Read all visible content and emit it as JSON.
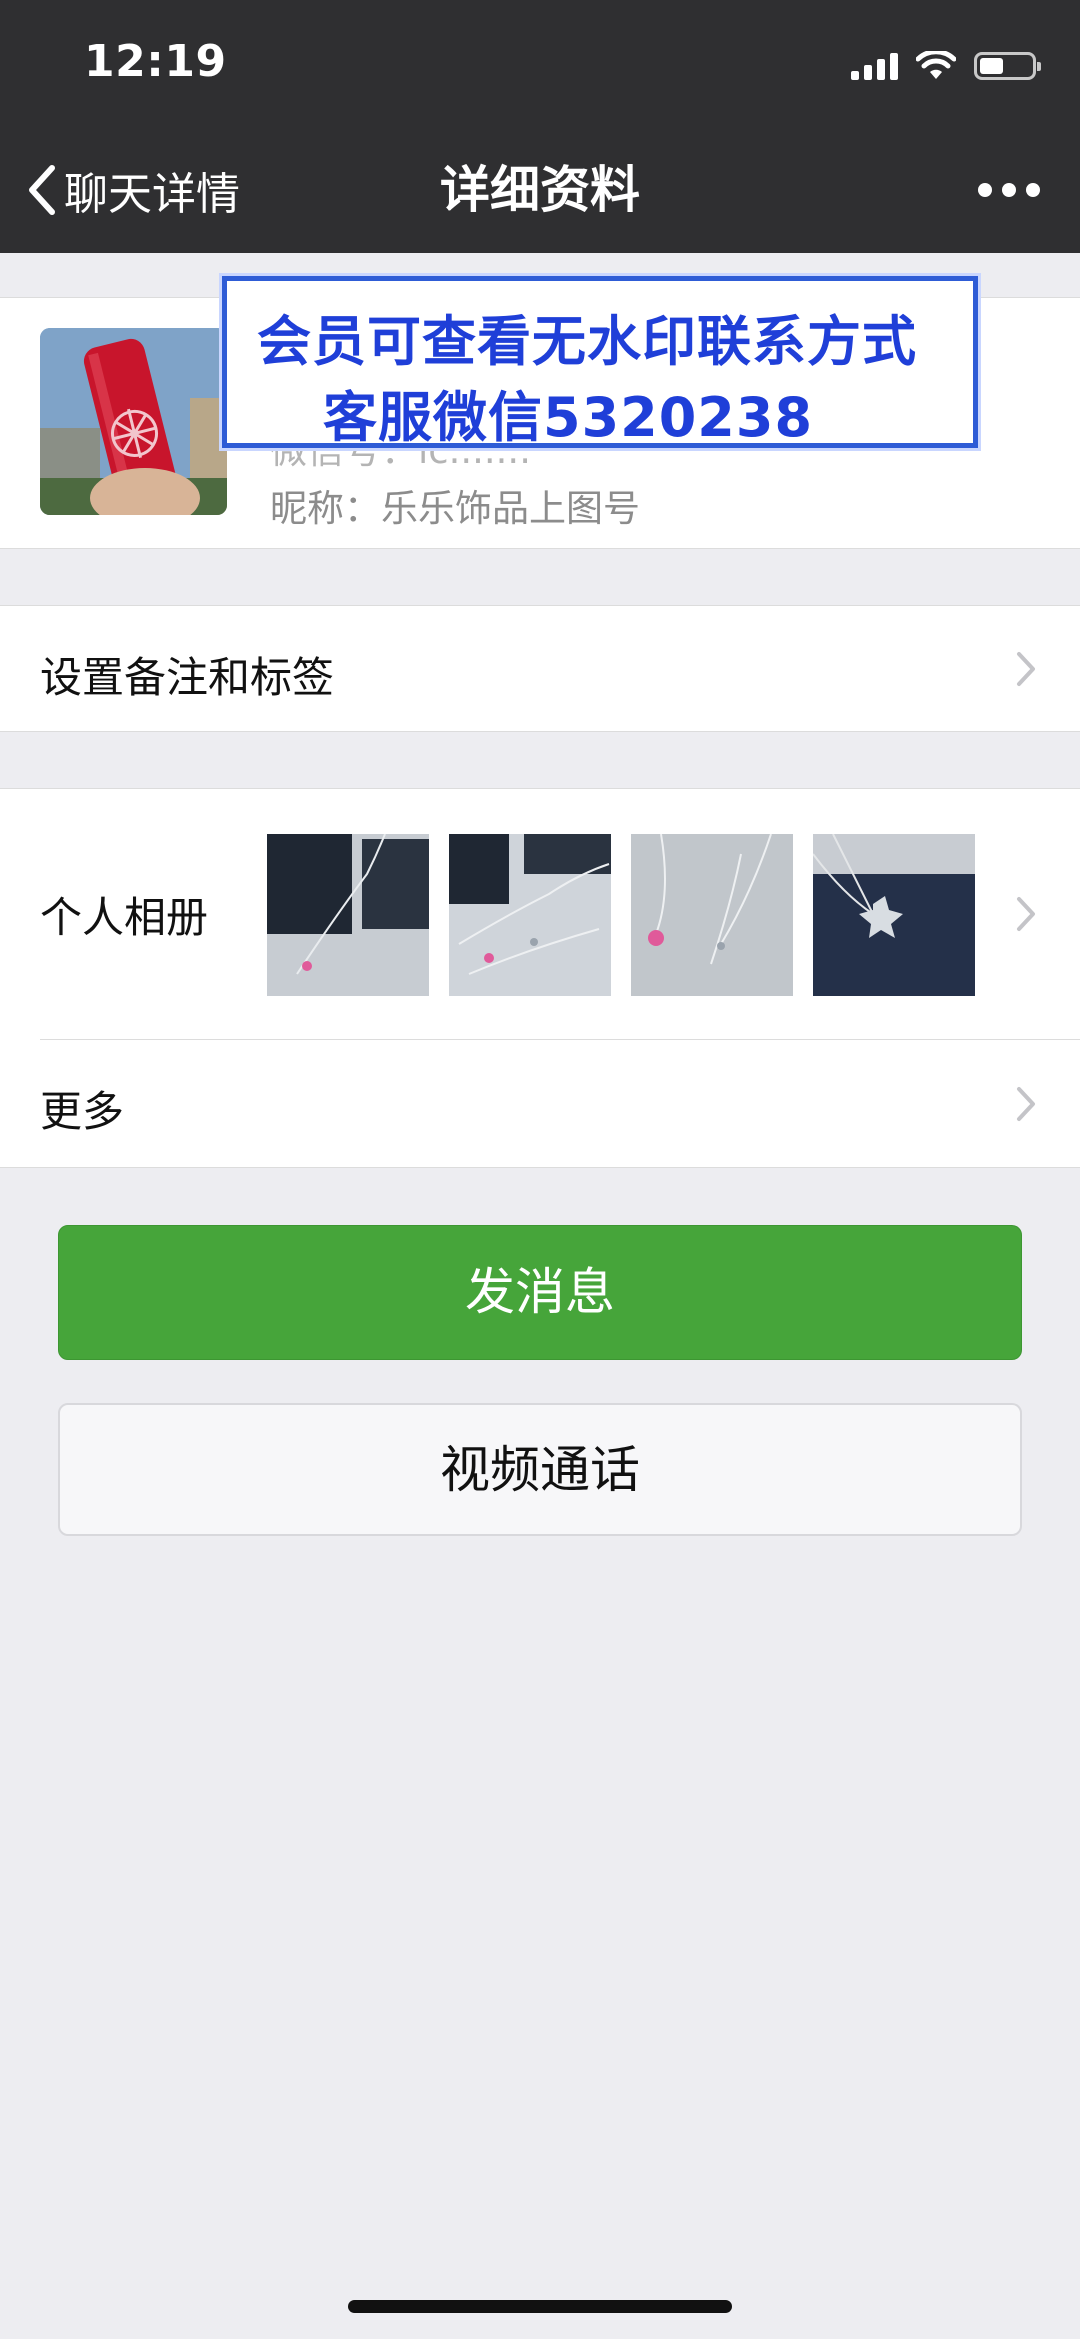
{
  "status_bar": {
    "time": "12:19",
    "battery_level": 0.45,
    "signal_bars": 4
  },
  "nav": {
    "back_label": "聊天详情",
    "title": "详细资料",
    "more_icon": "more-icon"
  },
  "profile": {
    "id_line_faded": "微信号：lc.......",
    "nickname_line": "昵称：乐乐饰品上图号"
  },
  "watermark": {
    "line1": "会员可查看无水印联系方式",
    "line2": "客服微信5320238"
  },
  "cells": {
    "remark_label": "设置备注和标签",
    "album_label": "个人相册",
    "more_label": "更多"
  },
  "buttons": {
    "message": "发消息",
    "video_call": "视频通话"
  },
  "colors": {
    "nav_background": "#2f2f31",
    "page_background": "#ededf1",
    "primary_green": "#46a53a",
    "watermark_blue": "#1f3fd8"
  }
}
